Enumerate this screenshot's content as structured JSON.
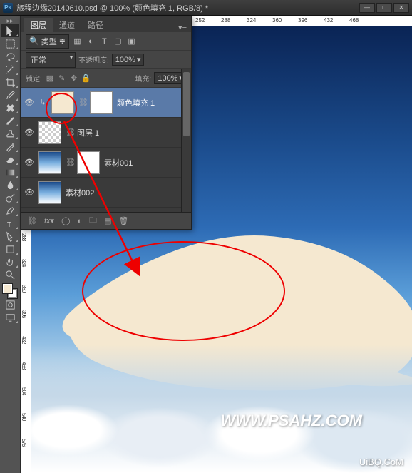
{
  "title": "旅程边缘20140610.psd @ 100% (颜色填充 1, RGB/8) *",
  "window_controls": {
    "min": "—",
    "max": "□",
    "close": "✕"
  },
  "ruler_h": [
    "252",
    "288",
    "324",
    "360",
    "396",
    "432",
    "468"
  ],
  "ruler_v": [
    "288",
    "324",
    "360",
    "396",
    "432",
    "468",
    "504",
    "540",
    "576"
  ],
  "watermark": "WWW.PSAHZ.COM",
  "watermark2": "UiBQ.CoM",
  "panel": {
    "tabs": {
      "layers": "图层",
      "channels": "通道",
      "paths": "路径"
    },
    "kind_label": "类型",
    "blend": "正常",
    "opacity_label": "不透明度:",
    "opacity_value": "100%",
    "lock_label": "锁定:",
    "fill_label": "填充:",
    "fill_value": "100%",
    "layers": [
      {
        "name": "颜色填充 1",
        "selected": true,
        "has_mask": true,
        "clipped": true,
        "thumb": "fill"
      },
      {
        "name": "图层 1",
        "thumb": "checker",
        "linked": true
      },
      {
        "name": "素材001",
        "thumb": "sky",
        "has_mask": true,
        "linked": true
      },
      {
        "name": "素材002",
        "thumb": "sky"
      }
    ]
  }
}
